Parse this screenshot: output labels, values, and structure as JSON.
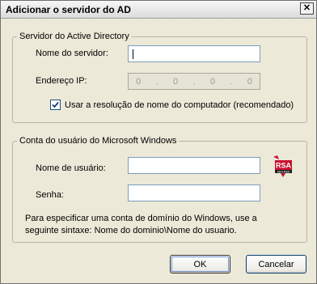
{
  "window": {
    "title": "Adicionar o servidor do AD",
    "close_glyph": "✕"
  },
  "ad_group": {
    "legend": "Servidor do Active Directory",
    "server_label": "Nome do servidor:",
    "server_value": "",
    "ip_label": "Endereço IP:",
    "ip_octets": [
      "0",
      "0",
      "0",
      "0"
    ],
    "ip_dot": ".",
    "checkbox_label": "Usar a resolução de nome do computador (recomendado)",
    "checkbox_checked": true
  },
  "user_group": {
    "legend": "Conta do usuário do Microsoft Windows",
    "username_label": "Nome de usuário:",
    "username_value": "",
    "password_label": "Senha:",
    "password_value": "",
    "help_text": "Para especificar uma conta de domínio do Windows, use a seguinte sintaxe: Nome  do  dominio\\Nome  do  usuario.",
    "rsa_logo_text": "RSA",
    "rsa_logo_subtext": "SECURED"
  },
  "buttons": {
    "ok": "OK",
    "cancel": "Cancelar"
  },
  "icons": {
    "close": "close-icon",
    "check": "checkmark-icon",
    "rsa": "rsa-secured-icon"
  },
  "colors": {
    "title_bg": "#dcdcdc",
    "dialog_bg": "#ece9d8",
    "field_border": "#7f9db9",
    "rsa_red": "#c8102e"
  }
}
